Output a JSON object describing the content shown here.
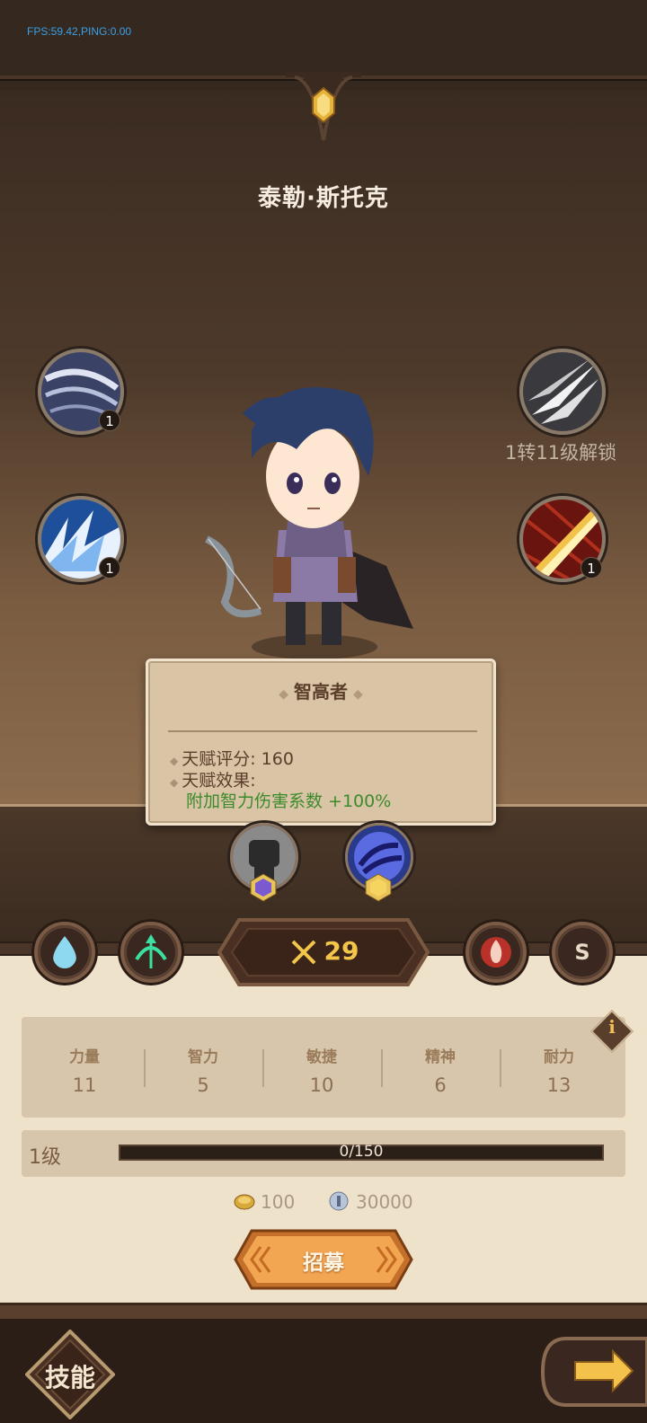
{
  "hud": {
    "fps_text": "FPS:59.42,PING:0.00"
  },
  "hero": {
    "name": "泰勒·斯托克"
  },
  "skills": {
    "left_top": {
      "level": "1",
      "icon": "wind-slash-icon"
    },
    "left_bottom": {
      "level": "1",
      "icon": "ice-shards-icon"
    },
    "right_top": {
      "icon": "feather-arrows-icon",
      "unlock_text": "1转11级解锁"
    },
    "right_bottom": {
      "level": "1",
      "icon": "fire-beam-icon"
    }
  },
  "talent_popup": {
    "title": "智高者",
    "score_label": "天赋评分: 160",
    "effect_label": "天赋效果:",
    "effect_text": "附加智力伤害系数 +100%"
  },
  "power": {
    "value": "29"
  },
  "side_buttons": {
    "s_label": "S"
  },
  "stats": [
    {
      "name": "力量",
      "value": "11"
    },
    {
      "name": "智力",
      "value": "5"
    },
    {
      "name": "敏捷",
      "value": "10"
    },
    {
      "name": "精神",
      "value": "6"
    },
    {
      "name": "耐力",
      "value": "13"
    }
  ],
  "level": {
    "label": "1级",
    "exp_text": "0/150",
    "exp_fraction": 0
  },
  "costs": {
    "gold": "100",
    "silver": "30000"
  },
  "recruit": {
    "label": "招募"
  },
  "footer": {
    "skill_label": "技能"
  },
  "colors": {
    "accent_gold": "#f3c64a",
    "effect_green": "#3d8a2c",
    "recruit_orange": "#f0a04a"
  }
}
